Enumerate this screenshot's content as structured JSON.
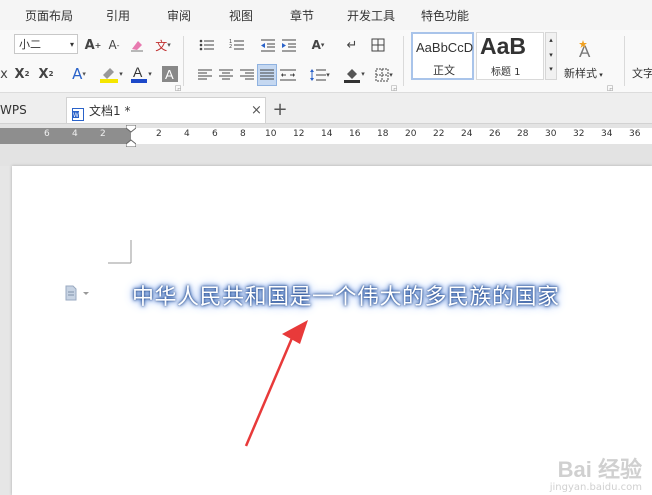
{
  "menu": [
    "页面布局",
    "引用",
    "审阅",
    "视图",
    "章节",
    "开发工具",
    "特色功能"
  ],
  "toolbar": {
    "font_size": "小二",
    "styles": [
      {
        "preview": "AaBbCcD",
        "label": "正文"
      },
      {
        "preview": "AaB",
        "label": "标题 1"
      }
    ],
    "new_style_label": "新样式",
    "text_label": "文字"
  },
  "tabs": {
    "first": "WPS",
    "doc_name": "文档1 *"
  },
  "ruler_numbers": [
    "6",
    "4",
    "2",
    "2",
    "4",
    "6",
    "8",
    "10",
    "12",
    "14",
    "16",
    "18",
    "20",
    "22",
    "24",
    "26",
    "28",
    "30",
    "32",
    "34",
    "36"
  ],
  "document": {
    "text": "中华人民共和国是一个伟大的多民族的国家"
  },
  "watermark": {
    "brand": "Bai 经验",
    "url": "jingyan.baidu.com"
  },
  "colors": {
    "text_glow": "#5a88d6",
    "arrow": "#e83a3a",
    "highlight_yellow": "#f5e600",
    "font_color_blue": "#1d49c9"
  }
}
